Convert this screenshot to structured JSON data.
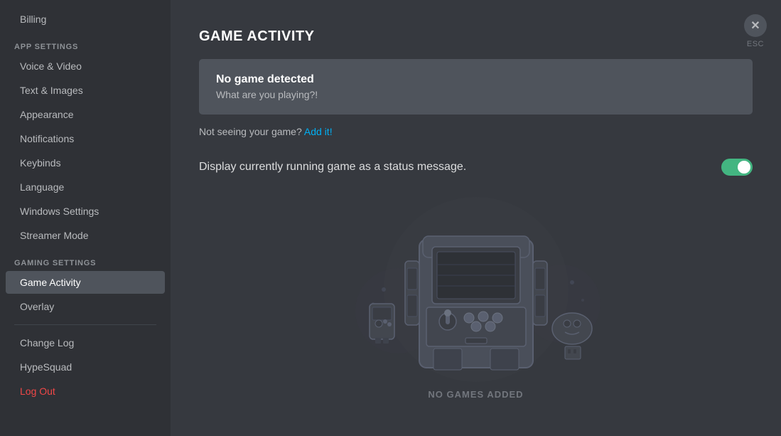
{
  "sidebar": {
    "sections": [
      {
        "label": "App Settings",
        "items": [
          {
            "id": "voice-video",
            "label": "Voice & Video",
            "active": false
          },
          {
            "id": "text-images",
            "label": "Text & Images",
            "active": false
          },
          {
            "id": "appearance",
            "label": "Appearance",
            "active": false
          },
          {
            "id": "notifications",
            "label": "Notifications",
            "active": false
          },
          {
            "id": "keybinds",
            "label": "Keybinds",
            "active": false
          },
          {
            "id": "language",
            "label": "Language",
            "active": false
          },
          {
            "id": "windows-settings",
            "label": "Windows Settings",
            "active": false
          },
          {
            "id": "streamer-mode",
            "label": "Streamer Mode",
            "active": false
          }
        ]
      },
      {
        "label": "Gaming Settings",
        "items": [
          {
            "id": "game-activity",
            "label": "Game Activity",
            "active": true
          },
          {
            "id": "overlay",
            "label": "Overlay",
            "active": false
          }
        ]
      }
    ],
    "footer_items": [
      {
        "id": "change-log",
        "label": "Change Log",
        "active": false,
        "danger": false
      },
      {
        "id": "hypesquad",
        "label": "HypeSquad",
        "active": false,
        "danger": false
      },
      {
        "id": "log-out",
        "label": "Log Out",
        "active": false,
        "danger": true
      }
    ],
    "billing_item": "Billing"
  },
  "main": {
    "title": "Game Activity",
    "no_game_card": {
      "title": "No game detected",
      "subtitle": "What are you playing?!"
    },
    "add_game_text": "Not seeing your game?",
    "add_game_link": "Add it!",
    "toggle_label": "Display currently running game as a status message.",
    "toggle_enabled": true,
    "no_games_label": "No Games Added"
  },
  "close_button": {
    "symbol": "✕",
    "esc_label": "ESC"
  }
}
